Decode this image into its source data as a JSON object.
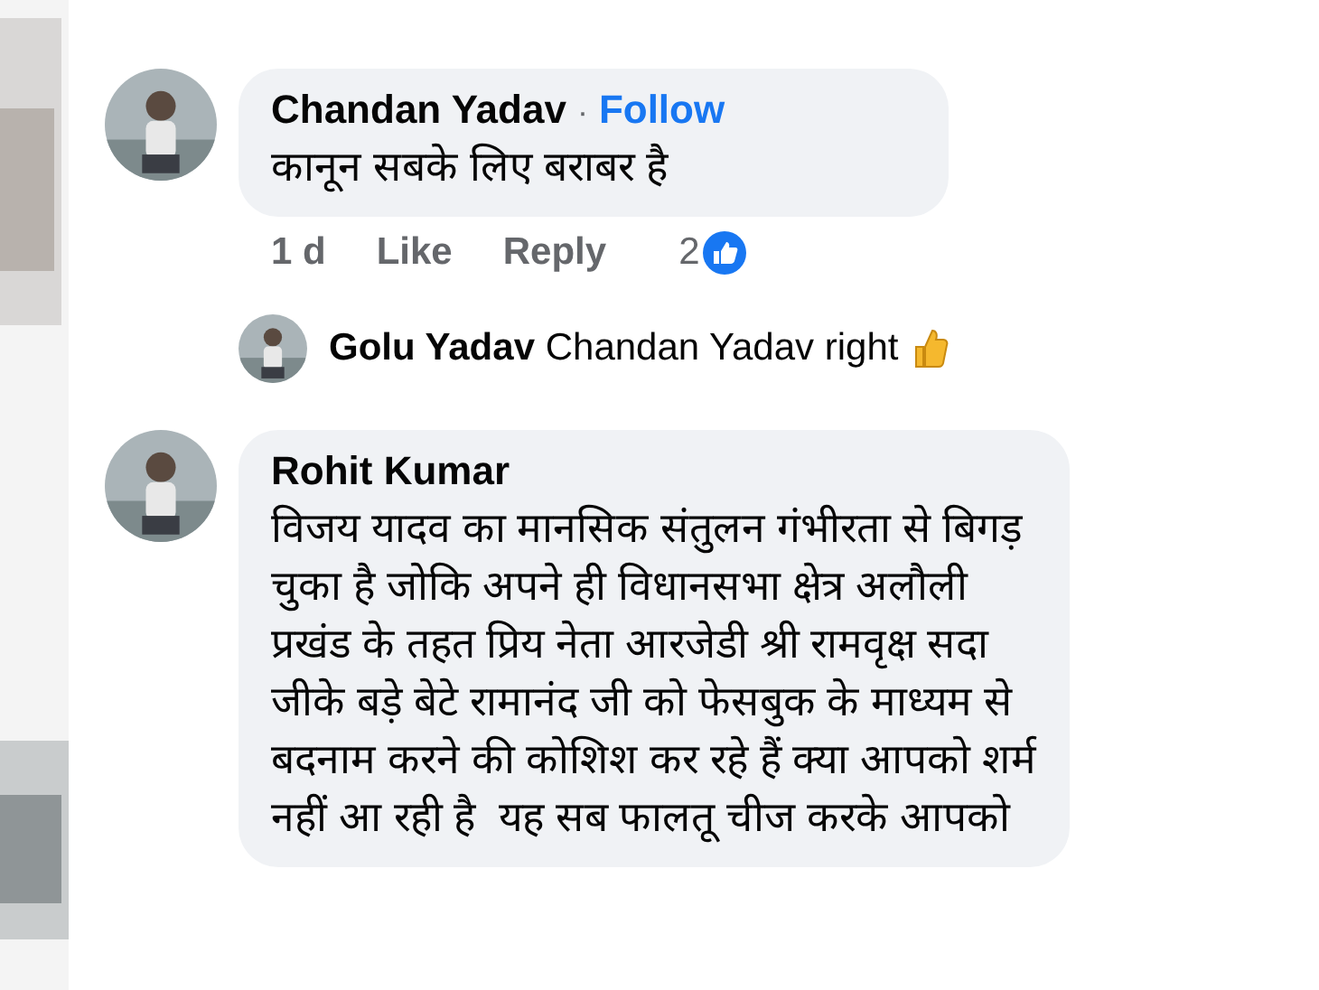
{
  "comments": [
    {
      "author": "Chandan Yadav",
      "separator": "·",
      "follow": "Follow",
      "lines": [
        "कानून सबके लिए बराबर है"
      ],
      "time": "1 d",
      "like": "Like",
      "reply": "Reply",
      "reactions": "2",
      "replies": [
        {
          "author": "Golu Yadav",
          "text": "Chandan Yadav right"
        }
      ]
    },
    {
      "author": "Rohit Kumar",
      "lines": [
        "विजय यादव का मानसिक संतुलन गंभीरता से बिगड़",
        "चुका है जोकि अपने ही विधानसभा क्षेत्र अलौली",
        "प्रखंड के तहत प्रिय नेता आरजेडी श्री रामवृक्ष सदा",
        "जीके बड़े बेटे रामानंद जी को फेसबुक के माध्यम से",
        "बदनाम करने की कोशिश कर रहे हैं क्या आपको शर्म",
        "नहीं आ रही है  यह सब फालतू चीज करके आपको"
      ]
    }
  ]
}
